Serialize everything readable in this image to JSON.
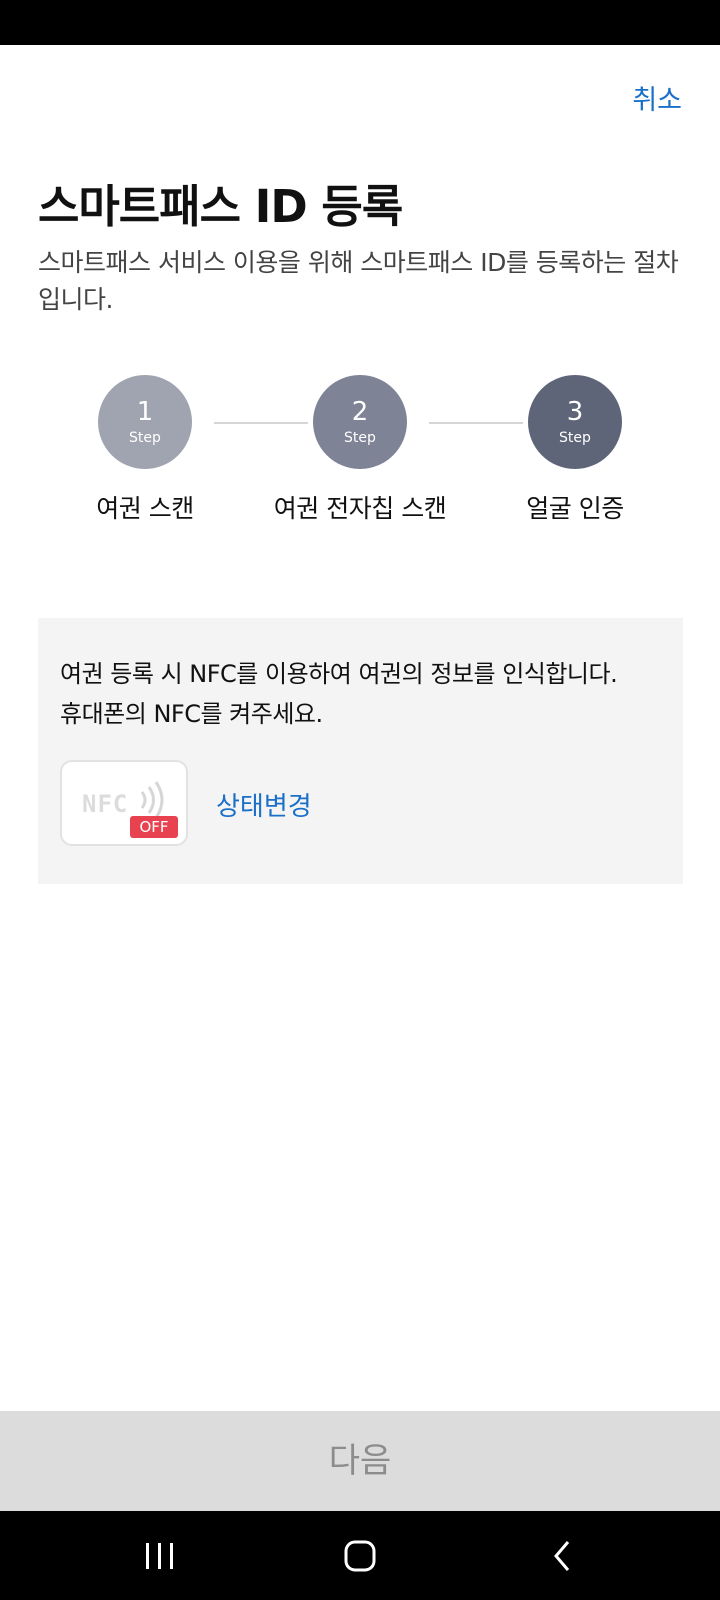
{
  "colors": {
    "accent": "#1a6fc9",
    "danger": "#e8414f",
    "step1": "#a0a3b0",
    "step2": "#7e8396",
    "step3": "#5f6579"
  },
  "header": {
    "cancel_label": "취소",
    "title": "스마트패스 ID 등록",
    "description": "스마트패스 서비스 이용을 위해 스마트패스 ID를 등록하는 절차입니다."
  },
  "steps": [
    {
      "number": "1",
      "sub": "Step",
      "label": "여권 스캔"
    },
    {
      "number": "2",
      "sub": "Step",
      "label": "여권 전자칩 스캔"
    },
    {
      "number": "3",
      "sub": "Step",
      "label": "얼굴 인증"
    }
  ],
  "nfc_notice": {
    "line1": "여권 등록 시 NFC를 이용하여 여권의 정보를 인식합니다.",
    "line2": "휴대폰의 NFC를 켜주세요.",
    "badge_text": "NFC",
    "badge_state": "OFF",
    "status_change_label": "상태변경",
    "icon": "nfc-icon"
  },
  "footer": {
    "next_label": "다음"
  },
  "nav": {
    "icons": [
      "recent-apps-icon",
      "home-icon",
      "back-icon"
    ]
  }
}
